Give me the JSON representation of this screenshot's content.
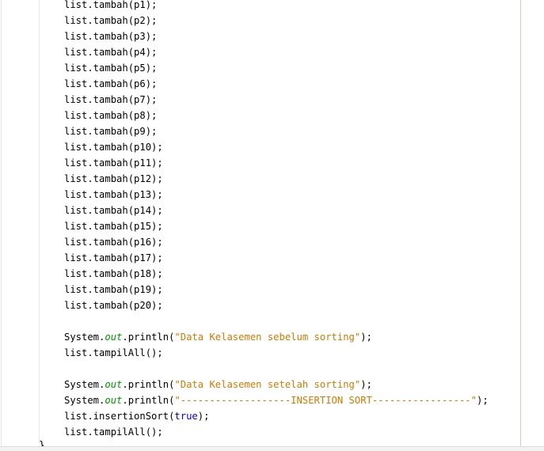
{
  "editor": {
    "lines": [
      [
        {
          "t": "list.tambah(p1);"
        }
      ],
      [
        {
          "t": "list.tambah(p2);"
        }
      ],
      [
        {
          "t": "list.tambah(p3);"
        }
      ],
      [
        {
          "t": "list.tambah(p4);"
        }
      ],
      [
        {
          "t": "list.tambah(p5);"
        }
      ],
      [
        {
          "t": "list.tambah(p6);"
        }
      ],
      [
        {
          "t": "list.tambah(p7);"
        }
      ],
      [
        {
          "t": "list.tambah(p8);"
        }
      ],
      [
        {
          "t": "list.tambah(p9);"
        }
      ],
      [
        {
          "t": "list.tambah(p10);"
        }
      ],
      [
        {
          "t": "list.tambah(p11);"
        }
      ],
      [
        {
          "t": "list.tambah(p12);"
        }
      ],
      [
        {
          "t": "list.tambah(p13);"
        }
      ],
      [
        {
          "t": "list.tambah(p14);"
        }
      ],
      [
        {
          "t": "list.tambah(p15);"
        }
      ],
      [
        {
          "t": "list.tambah(p16);"
        }
      ],
      [
        {
          "t": "list.tambah(p17);"
        }
      ],
      [
        {
          "t": "list.tambah(p18);"
        }
      ],
      [
        {
          "t": "list.tambah(p19);"
        }
      ],
      [
        {
          "t": "list.tambah(p20);"
        }
      ],
      [],
      [
        {
          "t": "System."
        },
        {
          "t": "out",
          "c": "fld"
        },
        {
          "t": ".println("
        },
        {
          "t": "\"Data Kelasemen sebelum sorting\"",
          "c": "str"
        },
        {
          "t": ");"
        }
      ],
      [
        {
          "t": "list.tampilAll();"
        }
      ],
      [],
      [
        {
          "t": "System."
        },
        {
          "t": "out",
          "c": "fld"
        },
        {
          "t": ".println("
        },
        {
          "t": "\"Data Kelasemen setelah sorting\"",
          "c": "str"
        },
        {
          "t": ");"
        }
      ],
      [
        {
          "t": "System."
        },
        {
          "t": "out",
          "c": "fld"
        },
        {
          "t": ".println("
        },
        {
          "t": "\"-------------------INSERTION SORT-----------------\"",
          "c": "str"
        },
        {
          "t": ");"
        }
      ],
      [
        {
          "t": "list.insertionSort("
        },
        {
          "t": "true",
          "c": "kw"
        },
        {
          "t": ");"
        }
      ],
      [
        {
          "t": "list.tampilAll();"
        }
      ]
    ],
    "closing_brace": "}"
  }
}
